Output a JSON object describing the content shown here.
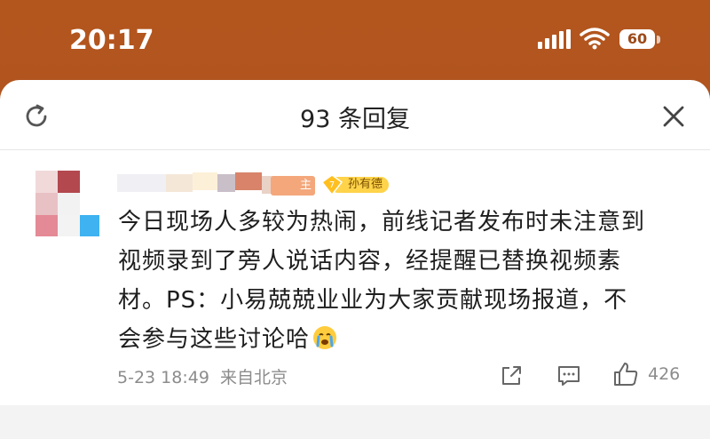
{
  "status_bar": {
    "time": "20:17",
    "battery": "60"
  },
  "sheet": {
    "title": "93 条回复"
  },
  "comment": {
    "owner_badge": "主",
    "level_badge": "孙有德",
    "lines": [
      "今日现场人多较为热闹，前线记者发布时未注意到",
      "视频录到了旁人说话内容，经提醒已替换视频素",
      "材。PS：小易兢兢业业为大家贡献现场报道，不",
      "会参与这些讨论哈"
    ],
    "emoji": "crying-face-icon",
    "timestamp": "5-23 18:49",
    "location": "来自北京",
    "likes": "426"
  },
  "colors": {
    "accent_bg": "#b3561e",
    "badge_yellow": "#ffd34a",
    "meta_gray": "#8c8c8c"
  }
}
